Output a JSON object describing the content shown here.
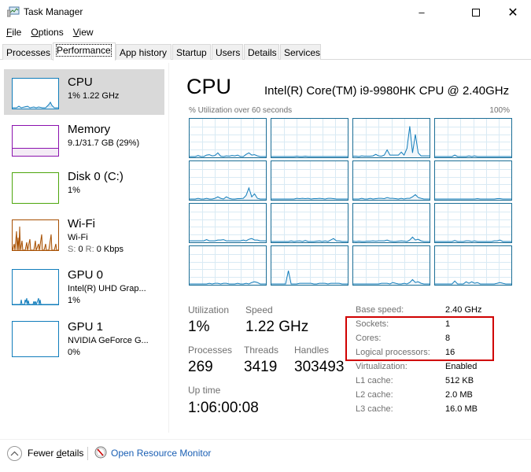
{
  "window": {
    "title": "Task Manager",
    "icon": "task-manager-icon",
    "controls": [
      "minimize",
      "maximize",
      "close"
    ]
  },
  "menu": [
    {
      "label": "File",
      "mnemonic": "F"
    },
    {
      "label": "Options",
      "mnemonic": "O"
    },
    {
      "label": "View",
      "mnemonic": "V"
    }
  ],
  "tabs": [
    {
      "label": "Processes",
      "active": false
    },
    {
      "label": "Performance",
      "active": true
    },
    {
      "label": "App history",
      "active": false
    },
    {
      "label": "Startup",
      "active": false
    },
    {
      "label": "Users",
      "active": false
    },
    {
      "label": "Details",
      "active": false
    },
    {
      "label": "Services",
      "active": false
    }
  ],
  "sidebar": {
    "items": [
      {
        "name": "CPU",
        "line1": "1% 1.22 GHz",
        "line2": "",
        "color": "#117dbb",
        "selected": true
      },
      {
        "name": "Memory",
        "line1": "9.1/31.7 GB (29%)",
        "line2": "",
        "color": "#8b12ae",
        "selected": false
      },
      {
        "name": "Disk 0 (C:)",
        "line1": "1%",
        "line2": "",
        "color": "#4da60c",
        "selected": false
      },
      {
        "name": "Wi-Fi",
        "line1": "Wi-Fi",
        "line2_send_label": "S:",
        "line2_send_value": "0",
        "line2_recv_label": "R:",
        "line2_recv_value": "0 Kbps",
        "color": "#a74f01",
        "selected": false
      },
      {
        "name": "GPU 0",
        "line1": "Intel(R) UHD Grap...",
        "line2": "1%",
        "color": "#117dbb",
        "selected": false
      },
      {
        "name": "GPU 1",
        "line1": "NVIDIA GeForce G...",
        "line2": "0%",
        "color": "#117dbb",
        "selected": false
      }
    ]
  },
  "main": {
    "title": "CPU",
    "cpu_model": "Intel(R) Core(TM) i9-9980HK CPU @ 2.40GHz",
    "graph_label": "% Utilization over 60 seconds",
    "graph_max_label": "100%",
    "logical_processor_graphs": 16,
    "stats": {
      "utilization_label": "Utilization",
      "utilization": "1%",
      "speed_label": "Speed",
      "speed": "1.22 GHz",
      "processes_label": "Processes",
      "processes": "269",
      "threads_label": "Threads",
      "threads": "3419",
      "handles_label": "Handles",
      "handles": "303493",
      "uptime_label": "Up time",
      "uptime": "1:06:00:08"
    },
    "details": [
      {
        "label": "Base speed:",
        "value": "2.40 GHz"
      },
      {
        "label": "Sockets:",
        "value": "1"
      },
      {
        "label": "Cores:",
        "value": "8"
      },
      {
        "label": "Logical processors:",
        "value": "16"
      },
      {
        "label": "Virtualization:",
        "value": "Enabled"
      },
      {
        "label": "L1 cache:",
        "value": "512 KB"
      },
      {
        "label": "L2 cache:",
        "value": "2.0 MB"
      },
      {
        "label": "L3 cache:",
        "value": "16.0 MB"
      }
    ],
    "highlight_color": "#d00000"
  },
  "footer": {
    "fewer_details": "Fewer details",
    "fewer_details_mnemonic": "d",
    "open_resource_monitor": "Open Resource Monitor"
  },
  "colors": {
    "graph_border": "#1c6e96",
    "graph_line": "#117dbb",
    "gridline": "#d9eaf4"
  }
}
